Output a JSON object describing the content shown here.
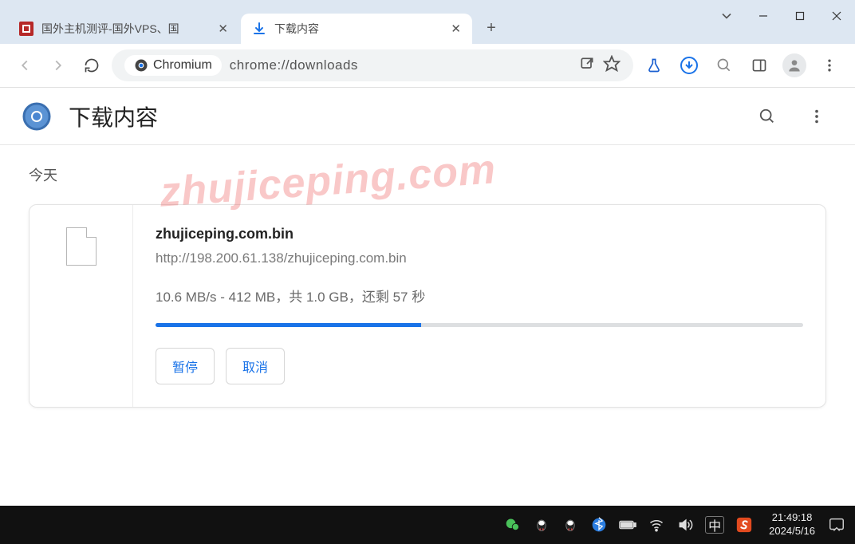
{
  "tabs": [
    {
      "title": "国外主机测评-国外VPS、国"
    },
    {
      "title": "下载内容"
    }
  ],
  "omnibox": {
    "chip": "Chromium",
    "url": "chrome://downloads"
  },
  "page": {
    "title": "下载内容",
    "section": "今天"
  },
  "download": {
    "filename": "zhujiceping.com.bin",
    "url": "http://198.200.61.138/zhujiceping.com.bin",
    "status": "10.6 MB/s - 412 MB，共 1.0 GB，还剩 57 秒",
    "progress_pct": 41,
    "pause_label": "暂停",
    "cancel_label": "取消"
  },
  "watermark": "zhujiceping.com",
  "taskbar": {
    "ime": "中",
    "time": "21:49:18",
    "date": "2024/5/16"
  }
}
